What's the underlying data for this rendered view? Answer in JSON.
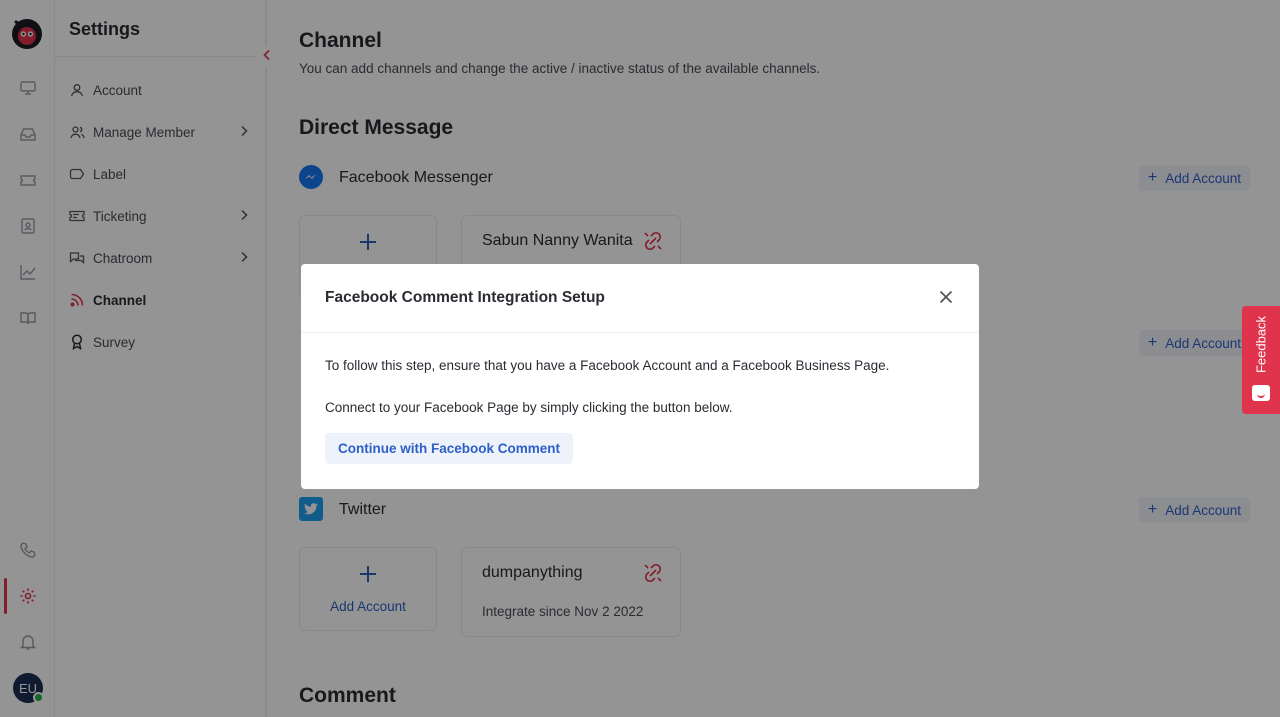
{
  "sidebar": {
    "title": "Settings",
    "items": [
      {
        "label": "Account",
        "icon": "user-icon"
      },
      {
        "label": "Manage Member",
        "icon": "users-icon"
      },
      {
        "label": "Label",
        "icon": "tag-icon"
      },
      {
        "label": "Ticketing",
        "icon": "ticket-icon"
      },
      {
        "label": "Chatroom",
        "icon": "chat-icon"
      },
      {
        "label": "Channel",
        "icon": "rss-icon"
      },
      {
        "label": "Survey",
        "icon": "trophy-icon"
      }
    ]
  },
  "rail": {
    "avatar_initials": "EU"
  },
  "main": {
    "title": "Channel",
    "subtitle": "You can add channels and change the active / inactive status of the available channels.",
    "direct_message_heading": "Direct Message",
    "comment_heading": "Comment",
    "add_account_label": "Add Account",
    "channels": {
      "facebook_messenger": {
        "name": "Facebook Messenger",
        "account_name": "Sabun Nanny Wanita"
      },
      "twitter": {
        "name": "Twitter",
        "account_name": "dumpanything",
        "since": "Integrate since Nov 2 2022"
      }
    }
  },
  "modal": {
    "title": "Facebook Comment Integration Setup",
    "line1": "To follow this step, ensure that you have a Facebook Account and a Facebook Business Page.",
    "line2": "Connect to your Facebook Page by simply clicking the button below.",
    "button": "Continue with Facebook Comment"
  },
  "feedback": {
    "label": "Feedback"
  },
  "colors": {
    "accent": "#e0334c",
    "link": "#2e5fc7",
    "facebook": "#1877f2",
    "twitter": "#1da1f2"
  }
}
